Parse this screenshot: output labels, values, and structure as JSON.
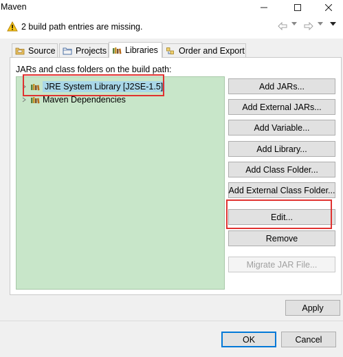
{
  "window": {
    "title": "Maven"
  },
  "message": {
    "text": "2 build path entries are missing."
  },
  "tabs": [
    {
      "label": "Source"
    },
    {
      "label": "Projects"
    },
    {
      "label": "Libraries"
    },
    {
      "label": "Order and Export"
    }
  ],
  "libraries": {
    "label": "JARs and class folders on the build path:",
    "entries": [
      {
        "label": "JRE System Library [J2SE-1.5]",
        "selected": true
      },
      {
        "label": "Maven Dependencies",
        "selected": false
      }
    ]
  },
  "buttons": {
    "add_jars": "Add JARs...",
    "add_external_jars": "Add External JARs...",
    "add_variable": "Add Variable...",
    "add_library": "Add Library...",
    "add_class_folder": "Add Class Folder...",
    "add_external_class_folder": "Add External Class Folder...",
    "edit": "Edit...",
    "remove": "Remove",
    "migrate_jar": "Migrate JAR File...",
    "apply": "Apply",
    "ok": "OK",
    "cancel": "Cancel"
  },
  "colors": {
    "tree_background": "#c8e6c9",
    "highlight_box": "#e0312f",
    "default_button_border": "#0078d7"
  }
}
